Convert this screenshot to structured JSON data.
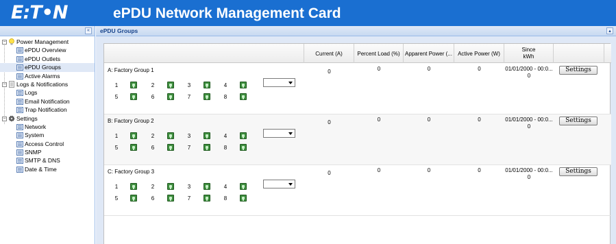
{
  "header": {
    "logo_text": "E:T•N",
    "title": "ePDU Network Management Card"
  },
  "sidebar": {
    "collapse_label": "«",
    "groups": [
      {
        "label": "Power Management",
        "icon": "lightbulb-icon",
        "items": [
          {
            "label": "ePDU Overview"
          },
          {
            "label": "ePDU Outlets"
          },
          {
            "label": "ePDU Groups"
          },
          {
            "label": "Active Alarms"
          }
        ]
      },
      {
        "label": "Logs & Notifications",
        "icon": "document-icon",
        "items": [
          {
            "label": "Logs"
          },
          {
            "label": "Email Notification"
          },
          {
            "label": "Trap Notification"
          }
        ]
      },
      {
        "label": "Settings",
        "icon": "gear-icon",
        "items": [
          {
            "label": "Network"
          },
          {
            "label": "System"
          },
          {
            "label": "Access Control"
          },
          {
            "label": "SNMP"
          },
          {
            "label": "SMTP & DNS"
          },
          {
            "label": "Date & Time"
          }
        ]
      }
    ],
    "selected": "ePDU Groups"
  },
  "panel": {
    "title": "ePDU Groups",
    "collapse_label": "▴"
  },
  "grid": {
    "columns": {
      "current": "Current (A)",
      "percent_load": "Percent Load (%)",
      "apparent_power": "Apparent Power (...",
      "active_power": "Active Power (W)",
      "since_line1": "Since",
      "since_line2": "kWh"
    },
    "rows": [
      {
        "name": "A:  Factory Group 1",
        "outlets": [
          "1",
          "2",
          "3",
          "4",
          "5",
          "6",
          "7",
          "8"
        ],
        "select_value": "",
        "current": "0",
        "percent_load": "0",
        "apparent_power": "0",
        "active_power": "0",
        "since_date": "01/01/2000 - 00:0...",
        "since_kwh": "0",
        "button": "Settings"
      },
      {
        "name": "B:  Factory Group 2",
        "outlets": [
          "1",
          "2",
          "3",
          "4",
          "5",
          "6",
          "7",
          "8"
        ],
        "select_value": "",
        "current": "0",
        "percent_load": "0",
        "apparent_power": "0",
        "active_power": "0",
        "since_date": "01/01/2000 - 00:0...",
        "since_kwh": "0",
        "button": "Settings"
      },
      {
        "name": "C:  Factory Group 3",
        "outlets": [
          "1",
          "2",
          "3",
          "4",
          "5",
          "6",
          "7",
          "8"
        ],
        "select_value": "",
        "current": "0",
        "percent_load": "0",
        "apparent_power": "0",
        "active_power": "0",
        "since_date": "01/01/2000 - 00:0...",
        "since_kwh": "0",
        "button": "Settings"
      }
    ]
  }
}
